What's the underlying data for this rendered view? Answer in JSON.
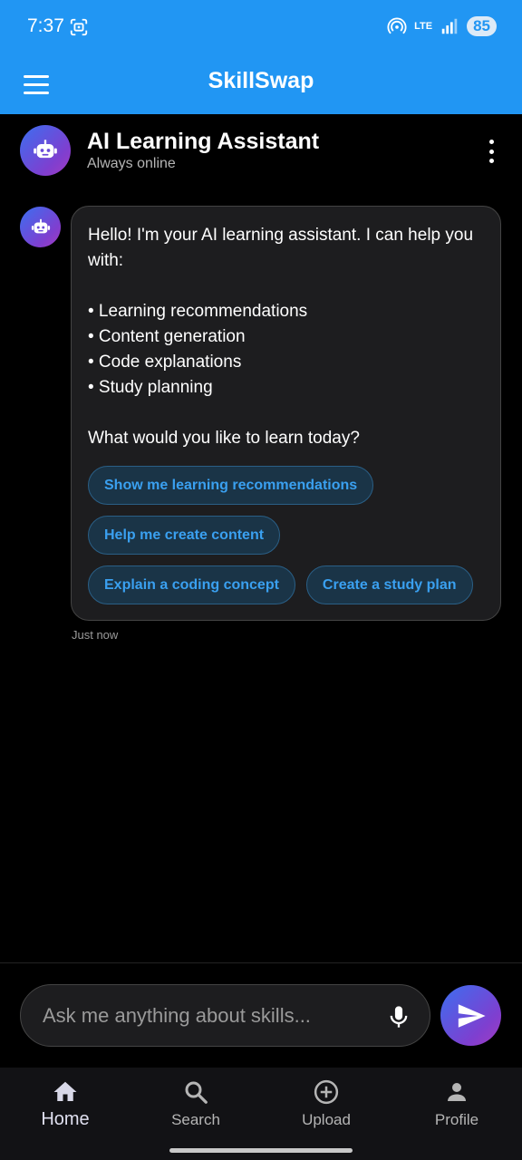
{
  "status_bar": {
    "time": "7:37",
    "network": "LTE",
    "battery": "85"
  },
  "app_bar": {
    "title": "SkillSwap"
  },
  "chat_header": {
    "title": "AI Learning Assistant",
    "subtitle": "Always online"
  },
  "message": {
    "text": "Hello! I'm your AI learning assistant. I can help you with:\n\n• Learning recommendations\n• Content generation\n• Code explanations\n• Study planning\n\nWhat would you like to learn today?",
    "timestamp": "Just now",
    "suggestions": [
      "Show me learning recommendations",
      "Help me create content",
      "Explain a coding concept",
      "Create a study plan"
    ]
  },
  "composer": {
    "placeholder": "Ask me anything about skills..."
  },
  "bottom_nav": {
    "items": [
      {
        "label": "Home",
        "icon": "home-icon",
        "active": true
      },
      {
        "label": "Search",
        "icon": "search-icon",
        "active": false
      },
      {
        "label": "Upload",
        "icon": "add-circle-icon",
        "active": false
      },
      {
        "label": "Profile",
        "icon": "person-icon",
        "active": false
      }
    ]
  },
  "colors": {
    "primary": "#2196F3",
    "background": "#000000",
    "chip_text": "#3aa0f0",
    "accent_gradient_start": "#3b6ff0",
    "accent_gradient_end": "#a33bc0"
  }
}
